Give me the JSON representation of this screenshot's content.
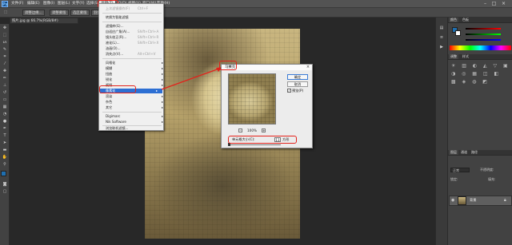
{
  "app": {
    "logo": "Ps"
  },
  "menubar": {
    "items": [
      "文件(F)",
      "编辑(E)",
      "图像(I)",
      "图层(L)",
      "文字(Y)",
      "选择(S)",
      "滤镜(T)",
      "3D(D)",
      "视图(V)",
      "窗口(W)",
      "帮助(H)"
    ],
    "active": "滤镜(T)"
  },
  "options_bar": {
    "tool_icon": "marquee-icon",
    "btn1": "调整边缘...",
    "btn2": "调整蒙版",
    "btn3": "选区蒙版",
    "btn4": "羽化"
  },
  "document_tab": {
    "title": "照片.jpg @ 66.7%(RGB/8#)"
  },
  "filter_menu": {
    "items": [
      {
        "label": "上次滤镜操作(F)",
        "shortcut": "Ctrl+F",
        "disabled": true
      },
      {
        "label": "转换为智能滤镜",
        "shortcut": ""
      },
      {
        "label": "滤镜库(G)...",
        "shortcut": ""
      },
      {
        "label": "自适应广角(A)...",
        "shortcut": "Shift+Ctrl+A"
      },
      {
        "label": "镜头校正(R)...",
        "shortcut": "Shift+Ctrl+R"
      },
      {
        "label": "液化(L)...",
        "shortcut": "Shift+Ctrl+X"
      },
      {
        "label": "油画(O)...",
        "shortcut": ""
      },
      {
        "label": "消失点(V)...",
        "shortcut": "Alt+Ctrl+V"
      },
      {
        "label": "风格化",
        "submenu": true
      },
      {
        "label": "模糊",
        "submenu": true
      },
      {
        "label": "扭曲",
        "submenu": true
      },
      {
        "label": "锐化",
        "submenu": true
      },
      {
        "label": "视频",
        "submenu": true
      },
      {
        "label": "像素化",
        "submenu": true,
        "highlighted": true
      },
      {
        "label": "渲染",
        "submenu": true
      },
      {
        "label": "杂色",
        "submenu": true
      },
      {
        "label": "其它",
        "submenu": true
      },
      {
        "label": "Digimarc",
        "submenu": true
      },
      {
        "label": "Nik Software",
        "submenu": true
      },
      {
        "label": "浏览联机滤镜...",
        "shortcut": ""
      }
    ]
  },
  "mosaic_dialog": {
    "title": "马赛克",
    "ok_label": "确定",
    "cancel_label": "取消",
    "preview_label": "预览(P)",
    "preview_checked": true,
    "zoom": "100%",
    "cell_size_label": "单元格大小(C):",
    "cell_size_value": "11",
    "cell_unit": "方形"
  },
  "right_panel": {
    "tabs_top": [
      "颜色",
      "色板"
    ],
    "tabs_mid": [
      "调整",
      "样式"
    ],
    "tabs_layers": [
      "图层",
      "通道",
      "路径"
    ],
    "layer_mode": "正常",
    "layer_opacity_label": "不透明度:",
    "layer_lock_label": "锁定:",
    "layer_fill_label": "填充:",
    "layer_name": "背景",
    "colors": {
      "fg": "#1f6fb0",
      "bg": "#ffffff",
      "accent": "#e3221b",
      "highlight": "#2d6fd3"
    }
  }
}
